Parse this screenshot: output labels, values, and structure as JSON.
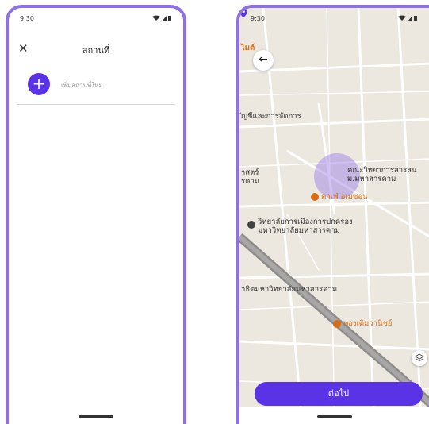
{
  "left_screen": {
    "status_time": "9:30",
    "close_icon": "close-icon",
    "title": "สถานที่",
    "add_button_symbol": "+",
    "add_label": "เพิ่มสถานที่ใหม่"
  },
  "right_screen": {
    "status_time": "9:30",
    "back_icon": "arrow-left-icon",
    "back_symbol": "←",
    "map_labels": {
      "top_fragment": "ไมต์",
      "accounting": "ัญชีและการจัดการ",
      "left_fragment": "าสตร์\nรคาม",
      "faculty": "คณะวิทยาการสารสน\nม.มหาสารคาม",
      "cafe": "คาเฟ่ อเมซอน",
      "college": "วิทยาลัยการเมืองการปกครอง\nมหาวิทยาลัยมหาสารคาม",
      "demo_school": "าธิตมหาวิทยาลัยมหาสารคาม",
      "shop": "ทองเติมวานิชย์"
    },
    "continue_label": "ต่อไป"
  },
  "colors": {
    "accent": "#5b33e6",
    "frame": "#8e71e8",
    "map_bg": "#ece7df",
    "poi_orange": "#d46f17"
  }
}
